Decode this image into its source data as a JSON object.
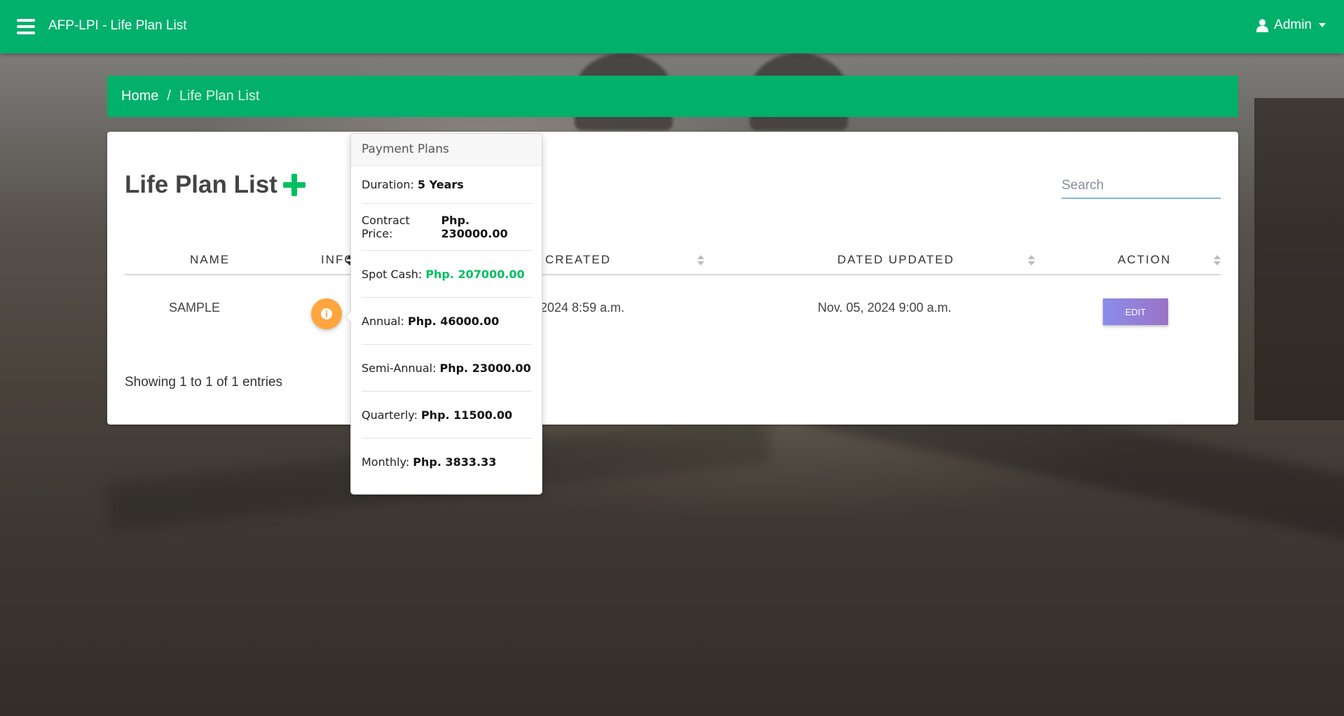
{
  "navbar": {
    "brand": "AFP-LPI - Life Plan List",
    "user": "Admin",
    "bg_color": "#00b06b"
  },
  "breadcrumb": {
    "home": "Home",
    "separator": "/",
    "current": "Life Plan List"
  },
  "page": {
    "title": "Life Plan List",
    "search_placeholder": "Search"
  },
  "table": {
    "headers": {
      "name": "NAME",
      "info": "INFO",
      "created": "CREATED",
      "updated": "DATED UPDATED",
      "action": "ACTION"
    },
    "rows": [
      {
        "name": "SAMPLE",
        "created": "2024 8:59 a.m.",
        "updated": "Nov. 05, 2024 9:00 a.m.",
        "action": "EDIT"
      }
    ],
    "footer": "Showing 1 to 1 of 1 entries"
  },
  "popover": {
    "title": "Payment Plans",
    "items": [
      {
        "label": "Duration:",
        "value": "5 Years"
      },
      {
        "label": "Contract Price:",
        "value": "Php. 230000.00"
      },
      {
        "label": "Spot Cash:",
        "value": "Php. 207000.00",
        "highlight_color": "#00bf60"
      },
      {
        "label": "Annual:",
        "value": "Php. 46000.00"
      },
      {
        "label": "Semi-Annual:",
        "value": "Php. 23000.00"
      },
      {
        "label": "Quarterly:",
        "value": "Php. 11500.00"
      },
      {
        "label": "Monthly:",
        "value": "Php. 3833.33"
      }
    ]
  },
  "colors": {
    "accent_green": "#00b06b",
    "info_button": "#ffa63e",
    "edit_button_gradient": [
      "#8c8de9",
      "#9b72c8"
    ]
  }
}
